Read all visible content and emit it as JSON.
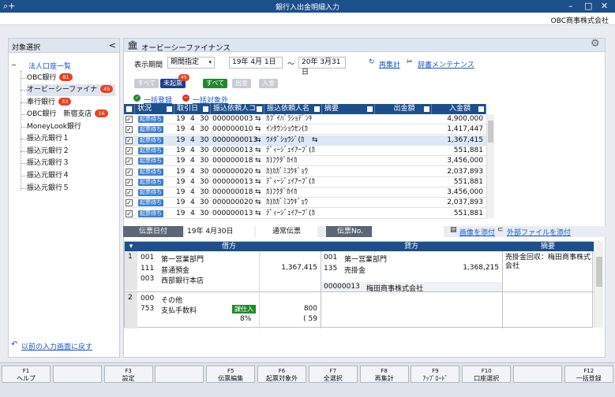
{
  "window": {
    "title": "銀行入出金明細入力",
    "company": "OBC商事株式会社"
  },
  "left": {
    "header": "対象選択",
    "collapse": "<",
    "root": "法人口座一覧",
    "items": [
      {
        "label": "OBC銀行",
        "badge": "81"
      },
      {
        "label": "オービーシーファイナ",
        "badge": "45"
      },
      {
        "label": "奉行銀行",
        "badge": "33"
      },
      {
        "label": "OBC銀行　新宿支店",
        "badge": "16"
      },
      {
        "label": "MoneyLook銀行",
        "badge": ""
      },
      {
        "label": "振込元銀行１",
        "badge": ""
      },
      {
        "label": "振込元銀行２",
        "badge": ""
      },
      {
        "label": "振込元銀行３",
        "badge": ""
      },
      {
        "label": "振込元銀行４",
        "badge": ""
      },
      {
        "label": "振込元銀行５",
        "badge": ""
      }
    ],
    "prev_link": "以前の入力画面に戻す"
  },
  "main": {
    "title": "オービーシーファイナンス",
    "period_label": "表示期間",
    "period_select": "期間指定",
    "date_from": "19年  4月  1日",
    "tilde": "～",
    "date_to": "20年  3月31日",
    "recalc": "再集計",
    "dict": "辞書メンテナンス",
    "f1_all": "すべて",
    "f1_unposted": "未起票",
    "f1_badge": "45",
    "f2_all": "すべて",
    "f2_out": "出金",
    "f2_in": "入金",
    "bulk_register": "一括登録",
    "bulk_exclude": "一括対象外"
  },
  "grid": {
    "headers": [
      "状況",
      "取引日",
      "振込依頼人コード",
      "振込依頼人名",
      "摘要",
      "出金額",
      "入金額"
    ],
    "rows": [
      {
        "status": "起票待ち",
        "y": "19",
        "m": "4",
        "d": "30",
        "code": "000000003",
        "name": "ｶﾌﾞｲﾊﾞﾗｼｮﾃﾞﾝｷ",
        "amount": "4,900,000"
      },
      {
        "status": "起票待ち",
        "y": "19",
        "m": "4",
        "d": "30",
        "code": "000000010",
        "name": "ｲﾝﾀｳﾝｼｮｳｾﾝ(ｶ",
        "amount": "1,417,447"
      },
      {
        "status": "起票待ち",
        "y": "19",
        "m": "4",
        "d": "30",
        "code": "0000000013",
        "name": "ｳﾒﾀﾞｼｮｳｼﾞ(ｶ",
        "amount": "1,367,415"
      },
      {
        "status": "起票待ち",
        "y": "19",
        "m": "4",
        "d": "30",
        "code": "000000013",
        "name": "ﾃﾞｨｰｼﾞｪｲｱｰﾌﾞ(ｶ",
        "amount": "551,881"
      },
      {
        "status": "起票待ち",
        "y": "19",
        "m": "4",
        "d": "30",
        "code": "000000018",
        "name": "ｶ)ﾌｸﾀﾞｶｲｶ",
        "amount": "3,456,000"
      },
      {
        "status": "起票待ち",
        "y": "19",
        "m": "4",
        "d": "30",
        "code": "000000020",
        "name": "ｶ)ｶｶﾞﾐｺｳｷﾞｮｳ",
        "amount": "2,037,893"
      },
      {
        "status": "起票待ち",
        "y": "19",
        "m": "4",
        "d": "30",
        "code": "000000013",
        "name": "ﾃﾞｨｰｼﾞｪｲｱｰﾌﾞ(ｶ",
        "amount": "551,881"
      },
      {
        "status": "起票待ち",
        "y": "19",
        "m": "4",
        "d": "30",
        "code": "000000018",
        "name": "ｶ)ﾌｸﾀﾞｶｲｶ",
        "amount": "3,456,000"
      },
      {
        "status": "起票待ち",
        "y": "19",
        "m": "4",
        "d": "30",
        "code": "000000020",
        "name": "ｶ)ｶｶﾞﾐｺｳｷﾞｮｳ",
        "amount": "2,037,893"
      },
      {
        "status": "起票待ち",
        "y": "19",
        "m": "4",
        "d": "30",
        "code": "000000013",
        "name": "ﾃﾞｨｰｼﾞｪｲｱｰﾌﾞ(ｶ",
        "amount": "551,881"
      }
    ]
  },
  "voucher": {
    "date_label": "伝票日付",
    "date_value": "19年  4月30日",
    "type": "通常伝票",
    "no_label": "伝票No.",
    "attach_image": "画像を添付",
    "attach_file": "外部ファイルを添付",
    "col_debit": "借方",
    "col_credit": "貸方",
    "col_memo": "摘要",
    "row1": {
      "no": "1",
      "d_dept_code": "001",
      "d_dept": "第一営業部門",
      "d_acct_code": "111",
      "d_acct": "普通預金",
      "d_sub_code": "003",
      "d_sub": "西部銀行本店",
      "d_amount": "1,367,415",
      "c_dept_code": "001",
      "c_dept": "第一営業部門",
      "c_acct_code": "135",
      "c_acct": "売掛金",
      "c_amount": "1,368,215",
      "c_partner_code": "00000013",
      "c_partner": "梅田商事株式会社",
      "memo": "売掛金回収：梅田商事株式会社"
    },
    "row2": {
      "no": "2",
      "d_dept_code": "000",
      "d_dept": "その他",
      "d_acct_code": "753",
      "d_acct": "支払手数料",
      "tax_tag": "課仕入",
      "tax_rate": "8%",
      "d_amount": "800",
      "d_tax": "( 59"
    }
  },
  "fkeys": [
    {
      "key": "F1",
      "label": "ヘルプ"
    },
    {
      "key": "",
      "label": ""
    },
    {
      "key": "F3",
      "label": "設定"
    },
    {
      "key": "",
      "label": ""
    },
    {
      "key": "F5",
      "label": "伝票編集"
    },
    {
      "key": "F6",
      "label": "起票対象外"
    },
    {
      "key": "F7",
      "label": "全選択"
    },
    {
      "key": "F8",
      "label": "再集計"
    },
    {
      "key": "F9",
      "label": "ｱｯﾌﾟﾛｰﾄﾞ"
    },
    {
      "key": "F10",
      "label": "口座選択"
    },
    {
      "key": "",
      "label": ""
    },
    {
      "key": "F12",
      "label": "一括登録"
    }
  ],
  "colors": {
    "navy": "#1d4f8c",
    "link": "#1a56c8",
    "badge": "#e8421e",
    "status": "#3f7fd0",
    "green": "#1f8a2a"
  }
}
